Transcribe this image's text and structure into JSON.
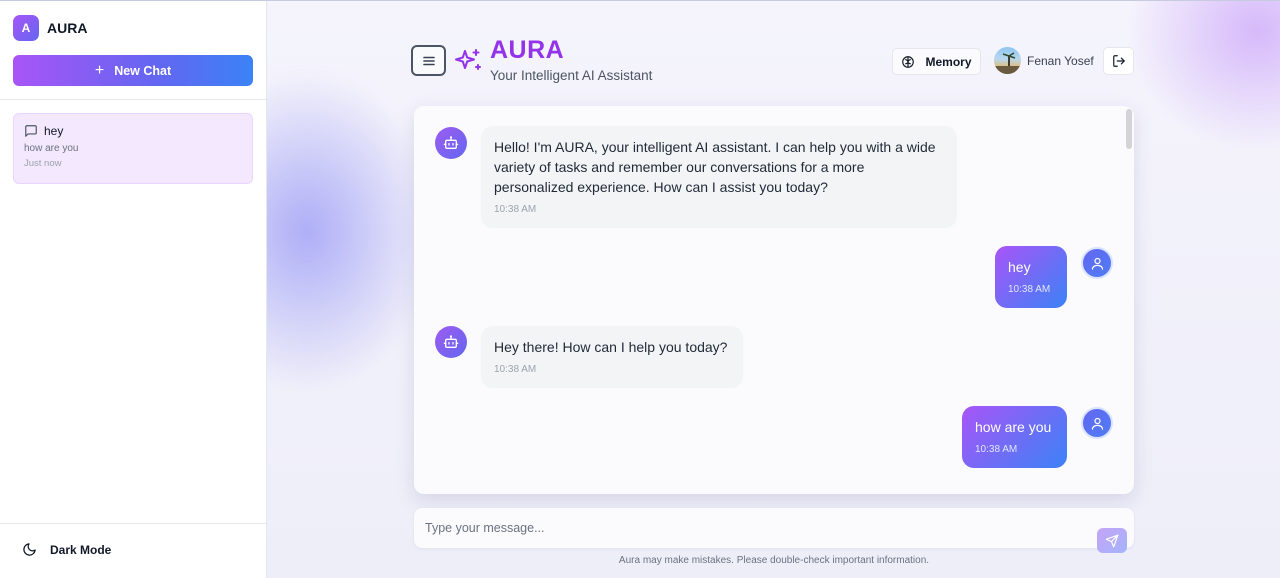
{
  "sidebar": {
    "brand_initial": "A",
    "brand_name": "AURA",
    "new_chat_label": "New Chat",
    "chats": [
      {
        "title": "hey",
        "preview": "how are you",
        "time": "Just now"
      }
    ],
    "dark_mode_label": "Dark Mode"
  },
  "header": {
    "title": "AURA",
    "subtitle": "Your Intelligent AI Assistant",
    "memory_label": "Memory",
    "user_name": "Fenan Yosef"
  },
  "messages": [
    {
      "role": "assistant",
      "text": "Hello! I'm AURA, your intelligent AI assistant. I can help you with a wide variety of tasks and remember our conversations for a more personalized experience. How can I assist you today?",
      "time": "10:38 AM"
    },
    {
      "role": "user",
      "text": "hey",
      "time": "10:38 AM"
    },
    {
      "role": "assistant",
      "text": "Hey there! How can I help you today?",
      "time": "10:38 AM"
    },
    {
      "role": "user",
      "text": "how are you",
      "time": "10:38 AM"
    }
  ],
  "composer": {
    "placeholder": "Type your message...",
    "disclaimer": "Aura may make mistakes. Please double-check important information."
  },
  "colors": {
    "accent_purple": "#a855f7",
    "accent_blue": "#3b82f6",
    "title_purple": "#9333ea"
  }
}
